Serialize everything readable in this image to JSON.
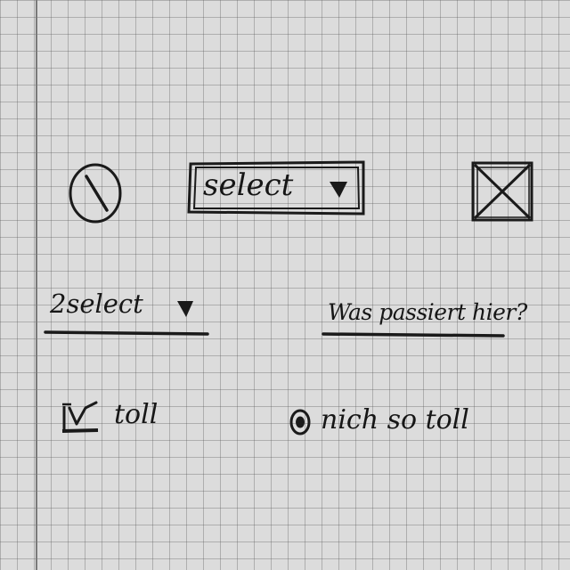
{
  "dropdown_boxed": {
    "label": "select"
  },
  "dropdown_underline": {
    "label": "2select"
  },
  "link": {
    "label": "Was passiert hier?"
  },
  "checkbox": {
    "label": "toll",
    "checked": true
  },
  "radio": {
    "label": "nich so toll",
    "selected": true
  },
  "icons": {
    "disabled": "no-entry-icon",
    "image_placeholder": "image-placeholder-icon",
    "dropdown_caret": "triangle-down-icon"
  }
}
